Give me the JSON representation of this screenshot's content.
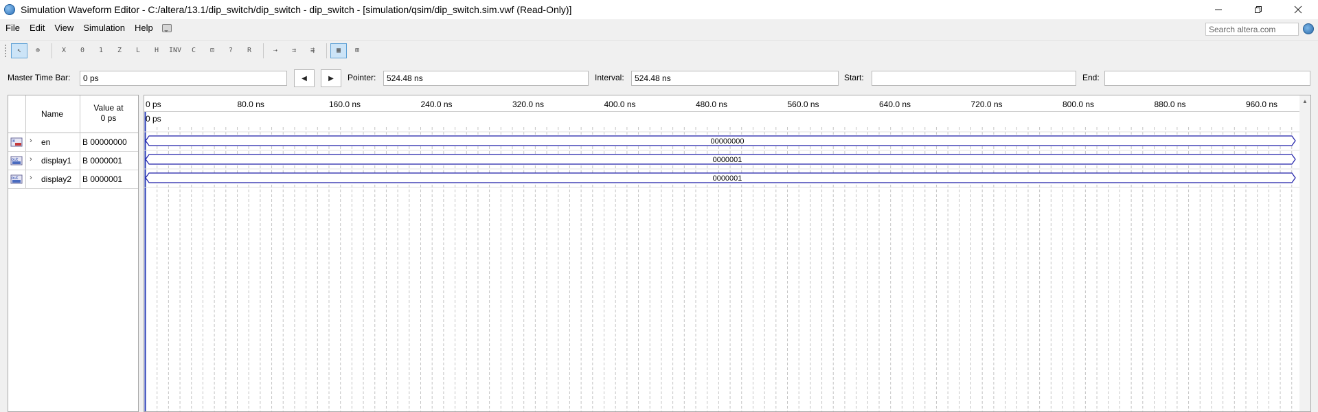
{
  "window": {
    "title": "Simulation Waveform Editor - C:/altera/13.1/dip_switch/dip_switch - dip_switch - [simulation/qsim/dip_switch.sim.vwf (Read-Only)]"
  },
  "menu": {
    "items": [
      "File",
      "Edit",
      "View",
      "Simulation",
      "Help"
    ],
    "search_placeholder": "Search altera.com"
  },
  "toolbar": {
    "buttons": [
      {
        "icon": "selection-tool-icon",
        "glyph": "↖",
        "active": true
      },
      {
        "icon": "zoom-tool-icon",
        "glyph": "⊕",
        "active": false
      },
      {
        "icon": "force-unknown-icon",
        "glyph": "X",
        "active": false
      },
      {
        "icon": "force-low-icon",
        "glyph": "0",
        "active": false
      },
      {
        "icon": "force-high-icon",
        "glyph": "1",
        "active": false
      },
      {
        "icon": "force-high-impedance-icon",
        "glyph": "Z",
        "active": false
      },
      {
        "icon": "force-weak-low-icon",
        "glyph": "L",
        "active": false
      },
      {
        "icon": "force-weak-high-icon",
        "glyph": "H",
        "active": false
      },
      {
        "icon": "invert-icon",
        "glyph": "INV",
        "active": false
      },
      {
        "icon": "count-value-icon",
        "glyph": "C",
        "active": false
      },
      {
        "icon": "clock-value-icon",
        "glyph": "⊡",
        "active": false
      },
      {
        "icon": "arbitrary-value-icon",
        "glyph": "?",
        "active": false
      },
      {
        "icon": "random-value-icon",
        "glyph": "R",
        "active": false
      },
      {
        "icon": "run-functional-simulation-icon",
        "glyph": "⇢",
        "active": false
      },
      {
        "icon": "run-timing-simulation-icon",
        "glyph": "⇉",
        "active": false
      },
      {
        "icon": "generate-netlist-icon",
        "glyph": "⇶",
        "active": false
      },
      {
        "icon": "snap-to-grid-icon",
        "glyph": "▦",
        "active": true
      },
      {
        "icon": "grid-settings-icon",
        "glyph": "⊞",
        "active": false
      }
    ]
  },
  "timebar": {
    "master_label": "Master Time Bar:",
    "master_value": "0 ps",
    "pointer_label": "Pointer:",
    "pointer_value": "524.48 ns",
    "interval_label": "Interval:",
    "interval_value": "524.48 ns",
    "start_label": "Start:",
    "start_value": "",
    "end_label": "End:",
    "end_value": ""
  },
  "signals": {
    "header_name": "Name",
    "header_value_line1": "Value at",
    "header_value_line2": "0 ps",
    "rows": [
      {
        "type_icon": "input-pin-icon",
        "name": "en",
        "value": "B 00000000",
        "wave": "00000000"
      },
      {
        "type_icon": "output-pin-icon",
        "name": "display1",
        "value": "B 0000001",
        "wave": "0000001"
      },
      {
        "type_icon": "output-pin-icon",
        "name": "display2",
        "value": "B 0000001",
        "wave": "0000001"
      }
    ]
  },
  "waveform": {
    "ticks": [
      "0 ps",
      "80.0 ns",
      "160.0 ns",
      "240.0 ns",
      "320.0 ns",
      "400.0 ns",
      "480.0 ns",
      "560.0 ns",
      "640.0 ns",
      "720.0 ns",
      "800.0 ns",
      "880.0 ns",
      "960.0 ns"
    ],
    "master_marker_label": "0 ps",
    "bus_color": "#1c1ca8",
    "marker_color": "#2b3fb8"
  }
}
